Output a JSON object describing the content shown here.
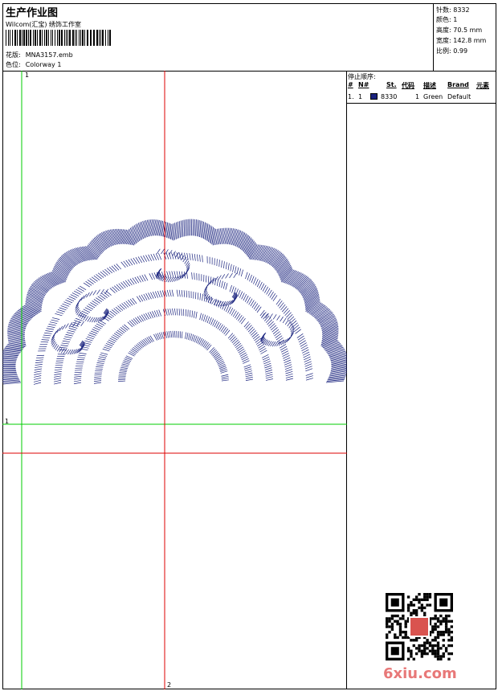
{
  "header": {
    "title": "生产作业图",
    "company": "Wilcom(汇宝) 绣饰工作室",
    "design_label": "花版:",
    "design_value": "MNA3157.emb",
    "colorway_label": "色位:",
    "colorway_value": "Colorway 1"
  },
  "stats": [
    {
      "label": "针数:",
      "value": "8332"
    },
    {
      "label": "颜色:",
      "value": "1"
    },
    {
      "label": "高度:",
      "value": "70.5 mm"
    },
    {
      "label": "宽度:",
      "value": "142.8 mm"
    },
    {
      "label": "比例:",
      "value": "0.99"
    }
  ],
  "panel": {
    "title": "停止顺序:",
    "columns": [
      "#",
      "N#",
      "St.",
      "代码",
      "描述",
      "Brand",
      "元素"
    ],
    "row": {
      "index": "1.",
      "needle": "1",
      "color": "#1a237e",
      "stitches": "8330",
      "code": "1",
      "description": "Green",
      "brand": "Default"
    }
  },
  "guides": {
    "vertical_green_label": "1",
    "horizontal_green_label": "1",
    "vertical_red_label": "2",
    "vertical_green_color": "#00cc00",
    "red_color": "#dd0000"
  },
  "design": {
    "thread_color": "#1a237e"
  },
  "watermark": "6xiu.com"
}
